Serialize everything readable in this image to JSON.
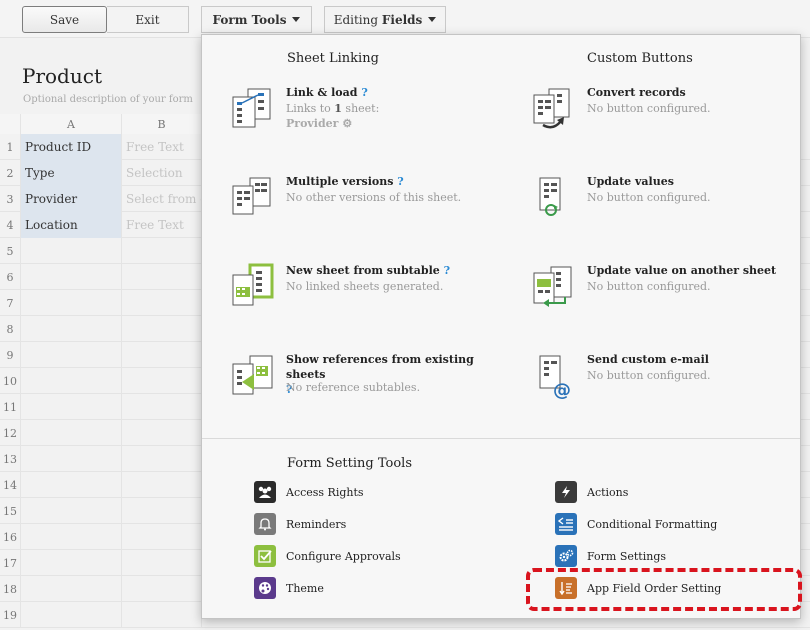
{
  "toolbar": {
    "save_label": "Save",
    "exit_label": "Exit",
    "form_tools_label": "Form Tools",
    "editing_label": "Editing",
    "fields_label": "Fields"
  },
  "form": {
    "title": "Product",
    "description": "Optional description of your form"
  },
  "sheet": {
    "columns": [
      "A",
      "B"
    ],
    "rows": [
      {
        "num": "1",
        "a": "Product ID",
        "b": "Free Text"
      },
      {
        "num": "2",
        "a": "Type",
        "b": "Selection"
      },
      {
        "num": "3",
        "a": "Provider",
        "b": "Select from ot"
      },
      {
        "num": "4",
        "a": "Location",
        "b": "Free Text"
      },
      {
        "num": "5",
        "a": "",
        "b": ""
      },
      {
        "num": "6",
        "a": "",
        "b": ""
      },
      {
        "num": "7",
        "a": "",
        "b": ""
      },
      {
        "num": "8",
        "a": "",
        "b": ""
      },
      {
        "num": "9",
        "a": "",
        "b": ""
      },
      {
        "num": "10",
        "a": "",
        "b": ""
      },
      {
        "num": "11",
        "a": "",
        "b": ""
      },
      {
        "num": "12",
        "a": "",
        "b": ""
      },
      {
        "num": "13",
        "a": "",
        "b": ""
      },
      {
        "num": "14",
        "a": "",
        "b": ""
      },
      {
        "num": "15",
        "a": "",
        "b": ""
      },
      {
        "num": "16",
        "a": "",
        "b": ""
      },
      {
        "num": "17",
        "a": "",
        "b": ""
      },
      {
        "num": "18",
        "a": "",
        "b": ""
      },
      {
        "num": "19",
        "a": "",
        "b": ""
      }
    ]
  },
  "panel": {
    "sheet_linking": {
      "title": "Sheet Linking",
      "link_load": {
        "name": "Link & load",
        "q": "?",
        "sub_pre": "Links to ",
        "sub_num": "1",
        "sub_post": " sheet:",
        "provider": "Provider"
      },
      "multiple_versions": {
        "name": "Multiple versions",
        "q": "?",
        "sub": "No other versions of this sheet."
      },
      "new_sheet": {
        "name": "New sheet from subtable",
        "q": "?",
        "sub": "No linked sheets generated."
      },
      "show_refs": {
        "name": "Show references from existing sheets",
        "q": "?",
        "sub": "No reference subtables."
      }
    },
    "custom_buttons": {
      "title": "Custom Buttons",
      "convert": {
        "name": "Convert records",
        "sub": "No button configured."
      },
      "update_values": {
        "name": "Update values",
        "sub": "No button configured."
      },
      "update_other": {
        "name": "Update value on another sheet",
        "sub": "No button configured."
      },
      "send_email": {
        "name": "Send custom e-mail",
        "sub": "No button configured."
      }
    },
    "form_setting_tools": {
      "title": "Form Setting Tools",
      "access_rights": "Access Rights",
      "reminders": "Reminders",
      "configure_approvals": "Configure Approvals",
      "theme": "Theme",
      "actions": "Actions",
      "conditional_formatting": "Conditional Formatting",
      "form_settings": "Form Settings",
      "app_field_order": "App Field Order Setting"
    }
  },
  "colors": {
    "access": "#2b2b2b",
    "reminders": "#7a7a7a",
    "approvals": "#8dbf3f",
    "theme": "#5b3a8c",
    "actions": "#3a3a3a",
    "conditional": "#2a72b8",
    "form_settings": "#2a72b8",
    "app_field": "#c8702a",
    "highlight": "#d9141e"
  }
}
